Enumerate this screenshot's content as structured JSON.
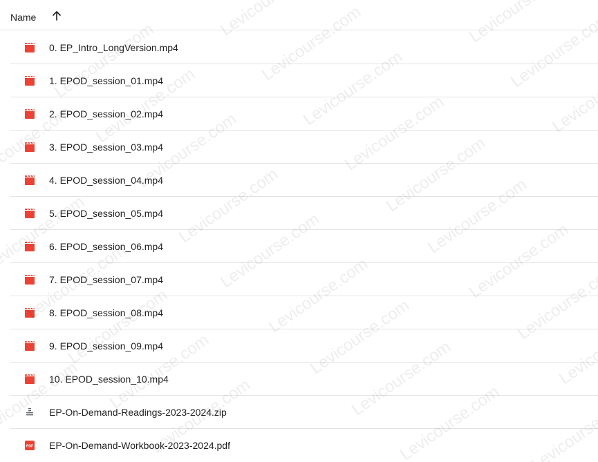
{
  "header": {
    "name_label": "Name",
    "sort_icon": "arrow-up-icon"
  },
  "files": [
    {
      "name": "0. EP_Intro_LongVersion.mp4",
      "type": "video"
    },
    {
      "name": "1. EPOD_session_01.mp4",
      "type": "video"
    },
    {
      "name": "2. EPOD_session_02.mp4",
      "type": "video"
    },
    {
      "name": "3. EPOD_session_03.mp4",
      "type": "video"
    },
    {
      "name": "4. EPOD_session_04.mp4",
      "type": "video"
    },
    {
      "name": "5. EPOD_session_05.mp4",
      "type": "video"
    },
    {
      "name": "6. EPOD_session_06.mp4",
      "type": "video"
    },
    {
      "name": "7. EPOD_session_07.mp4",
      "type": "video"
    },
    {
      "name": "8. EPOD_session_08.mp4",
      "type": "video"
    },
    {
      "name": "9. EPOD_session_09.mp4",
      "type": "video"
    },
    {
      "name": "10. EPOD_session_10.mp4",
      "type": "video"
    },
    {
      "name": "EP-On-Demand-Readings-2023-2024.zip",
      "type": "zip"
    },
    {
      "name": "EP-On-Demand-Workbook-2023-2024.pdf",
      "type": "pdf"
    }
  ],
  "watermark": {
    "text": "Levicourse.com"
  },
  "colors": {
    "video_icon": "#ea4335",
    "pdf_icon": "#ea4335",
    "zip_icon": "#5f6368",
    "divider": "#e3e3e3"
  }
}
